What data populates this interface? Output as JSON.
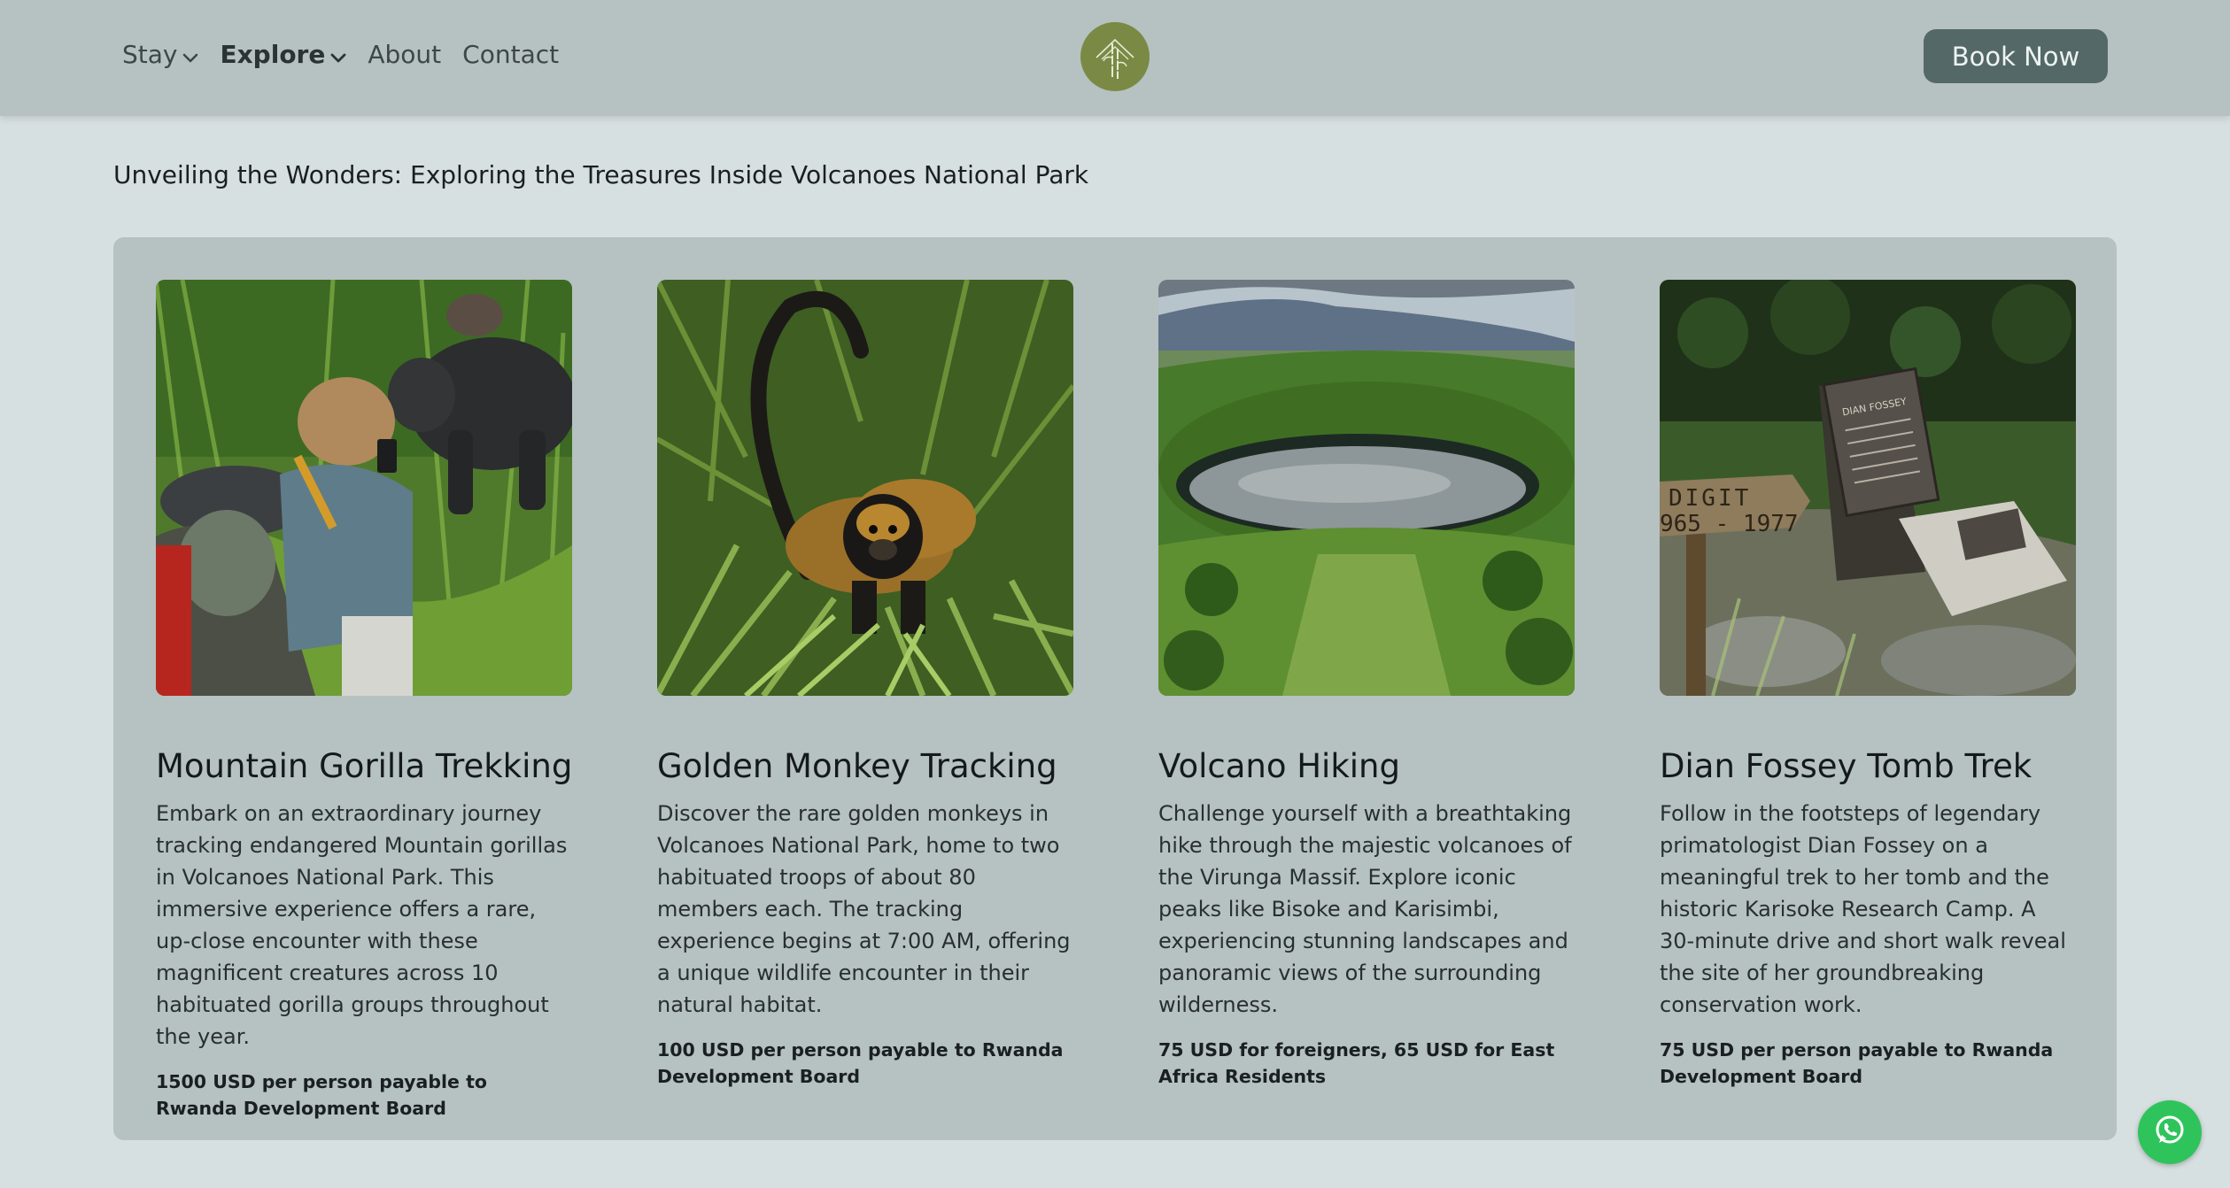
{
  "nav": {
    "items": [
      {
        "label": "Stay",
        "dropdown": true
      },
      {
        "label": "Explore",
        "dropdown": true
      },
      {
        "label": "About"
      },
      {
        "label": "Contact"
      }
    ],
    "book_button": "Book Now"
  },
  "page_title": "Unveiling the Wonders: Exploring the Treasures Inside Volcanoes National Park",
  "cards": [
    {
      "title": "Mountain Gorilla Trekking",
      "description": "Embark on an extraordinary journey tracking endangered Mountain gorillas in Volcanoes National Park. This immersive experience offers a rare, up-close encounter with these magnificent creatures across 10 habituated gorilla groups throughout the year.",
      "price": "1500 USD per person payable to Rwanda Development Board",
      "image_icon": "gorilla-trekking-photo"
    },
    {
      "title": "Golden Monkey Tracking",
      "description": "Discover the rare golden monkeys in Volcanoes National Park, home to two habituated troops of about 80 members each. The tracking experience begins at 7:00 AM, offering a unique wildlife encounter in their natural habitat.",
      "price": "100 USD per person payable to Rwanda Development Board",
      "image_icon": "golden-monkey-photo"
    },
    {
      "title": "Volcano Hiking",
      "description": "Challenge yourself with a breathtaking hike through the majestic volcanoes of the Virunga Massif. Explore iconic peaks like Bisoke and Karisimbi, experiencing stunning landscapes and panoramic views of the surrounding wilderness.",
      "price": "75 USD for foreigners, 65 USD for East Africa Residents",
      "image_icon": "crater-lake-photo"
    },
    {
      "title": "Dian Fossey Tomb Trek",
      "description": "Follow in the footsteps of legendary primatologist Dian Fossey on a meaningful trek to her tomb and the historic Karisoke Research Camp. A 30-minute drive and short walk reveal the site of her groundbreaking conservation work.",
      "price": "75 USD per person payable to Rwanda Development Board",
      "image_icon": "fossey-tomb-photo"
    }
  ],
  "image_text": {
    "sign_top": "DIGIT",
    "sign_bottom": "965 - 1977",
    "plaque_name": "DIAN FOSSEY"
  },
  "colors": {
    "header_bg": "#b6c1c1",
    "page_bg": "#d7e0e0",
    "button_bg": "#546967",
    "logo_bg": "#7a8a45",
    "whatsapp": "#2fc45b"
  }
}
